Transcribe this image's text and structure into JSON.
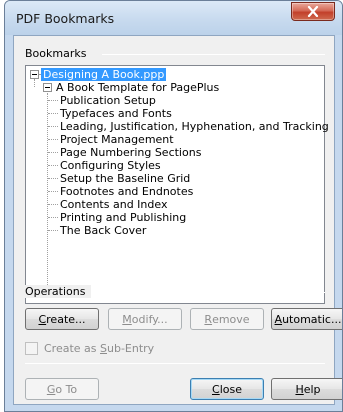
{
  "window": {
    "title": "PDF Bookmarks"
  },
  "groups": {
    "bookmarks": "Bookmarks",
    "operations": "Operations"
  },
  "tree": {
    "root": "Designing A Book.ppp",
    "child": "A Book Template for PagePlus",
    "items": [
      "Publication Setup",
      "Typefaces and Fonts",
      "Leading, Justification, Hyphenation, and Tracking",
      "Project Management",
      "Page Numbering Sections",
      "Configuring Styles",
      "Setup the Baseline Grid",
      "Footnotes and Endnotes",
      "Contents and Index",
      "Printing and Publishing",
      "The Back Cover"
    ]
  },
  "buttons": {
    "create_pre": "",
    "create_key": "C",
    "create_post": "reate...",
    "modify_pre": "",
    "modify_key": "M",
    "modify_post": "odify...",
    "remove_pre": "",
    "remove_key": "R",
    "remove_post": "emove",
    "automatic_pre": "",
    "automatic_key": "A",
    "automatic_post": "utomatic...",
    "goto_pre": "",
    "goto_key": "G",
    "goto_post": "o To",
    "close_pre": "",
    "close_key": "C",
    "close_post": "lose",
    "help_pre": "",
    "help_key": "H",
    "help_post": "elp"
  },
  "checkbox": {
    "pre": "Create as ",
    "key": "S",
    "post": "ub-Entry",
    "checked": false
  },
  "icons": {
    "close": "close-x-icon"
  },
  "colors": {
    "selection": "#3399ff",
    "close_button": "#c7432b",
    "titlebar": "#c6d9ee"
  }
}
